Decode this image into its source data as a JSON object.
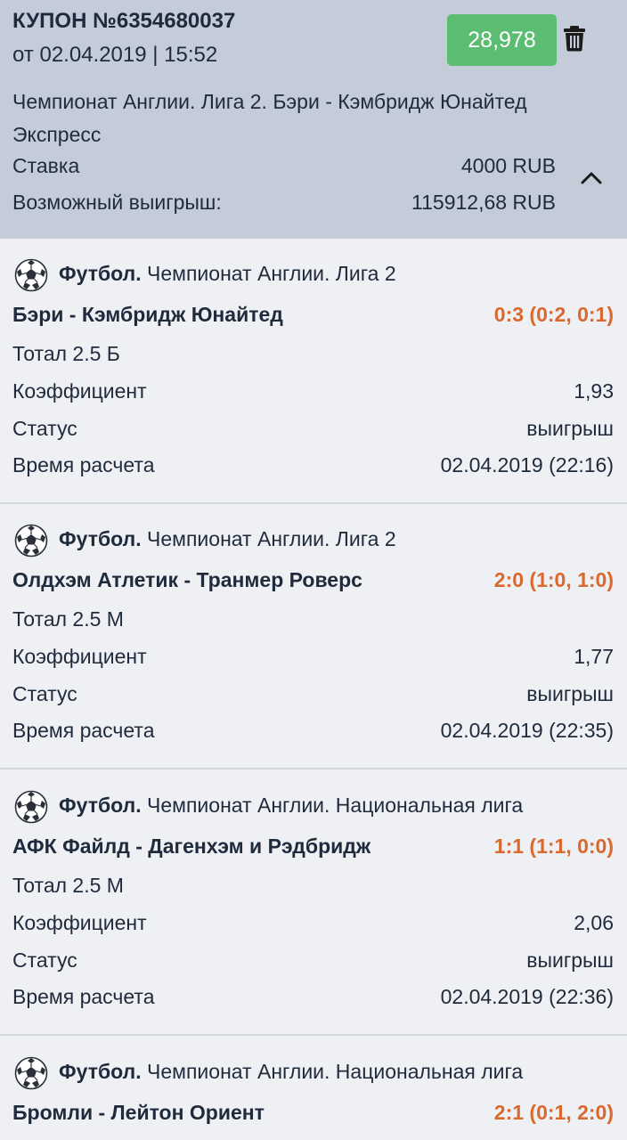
{
  "coupon": {
    "title": "КУПОН №6354680037",
    "date": "от 02.04.2019 | 15:52",
    "total_coef": "28,978",
    "event": "Чемпионат Англии. Лига 2. Бэри - Кэмбридж Юнайтед",
    "bet_type": "Экспресс",
    "stake_label": "Ставка",
    "stake_value": "4000 RUB",
    "win_label": "Возможный выигрыш:",
    "win_value": "115912,68 RUB",
    "accent_color": "#5bbd72"
  },
  "labels": {
    "coef": "Коэффициент",
    "status": "Статус",
    "settle_time": "Время расчета"
  },
  "bets": [
    {
      "sport": "Футбол.",
      "league": "Чемпионат Англии. Лига 2",
      "match": "Бэри - Кэмбридж Юнайтед",
      "score": "0:3 (0:2, 0:1)",
      "market": "Тотал 2.5 Б",
      "coef": "1,93",
      "status": "выигрыш",
      "settle_time": "02.04.2019 (22:16)"
    },
    {
      "sport": "Футбол.",
      "league": "Чемпионат Англии. Лига 2",
      "match": "Олдхэм Атлетик - Транмер Роверс",
      "score": "2:0 (1:0, 1:0)",
      "market": "Тотал 2.5 М",
      "coef": "1,77",
      "status": "выигрыш",
      "settle_time": "02.04.2019 (22:35)"
    },
    {
      "sport": "Футбол.",
      "league": "Чемпионат Англии. Национальная лига",
      "match": "АФК Файлд - Дагенхэм и Рэдбридж",
      "score": "1:1 (1:1, 0:0)",
      "market": "Тотал 2.5 М",
      "coef": "2,06",
      "status": "выигрыш",
      "settle_time": "02.04.2019 (22:36)"
    },
    {
      "sport": "Футбол.",
      "league": "Чемпионат Англии. Национальная лига",
      "match": "Бромли - Лейтон Ориент",
      "score": "2:1 (0:1, 2:0)"
    }
  ],
  "icons": {
    "sport": "football-icon",
    "delete": "trash-icon",
    "collapse": "chevron-up-icon"
  }
}
